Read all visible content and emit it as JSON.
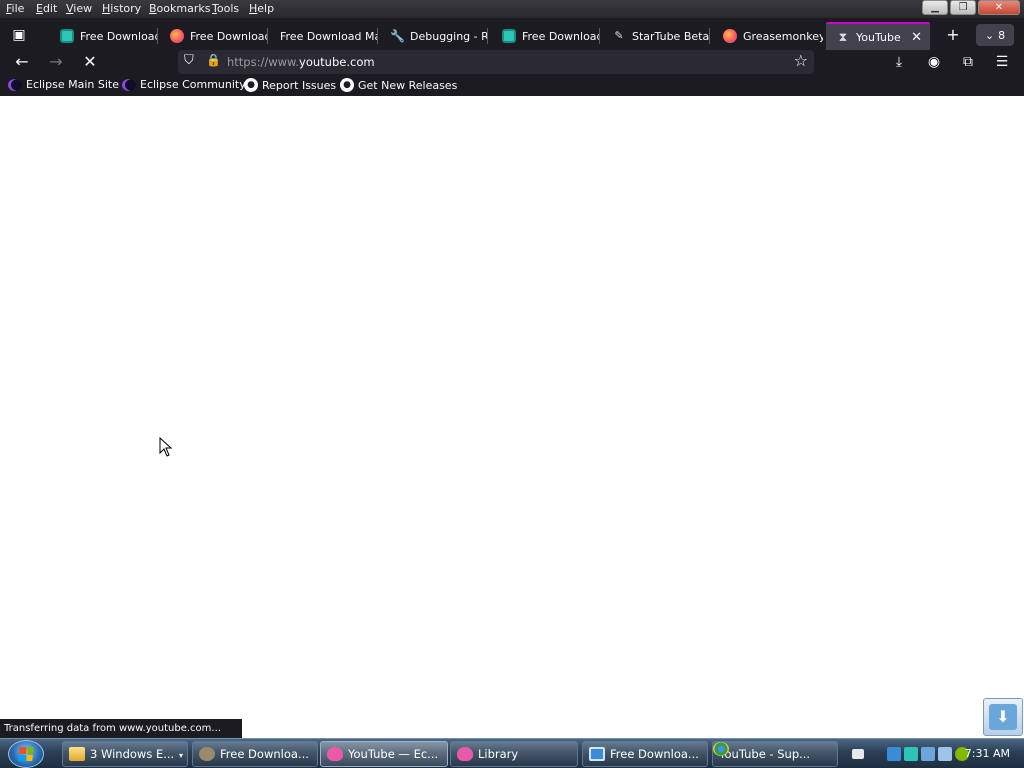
{
  "menubar": {
    "items": [
      "File",
      "Edit",
      "View",
      "History",
      "Bookmarks",
      "Tools",
      "Help"
    ]
  },
  "tabs": [
    {
      "label": "Free Download",
      "icon": "fdm-icon"
    },
    {
      "label": "Free Download",
      "icon": "firefox-icon"
    },
    {
      "label": "Free Download Ma",
      "icon": ""
    },
    {
      "label": "Debugging - R",
      "icon": "wrench-icon"
    },
    {
      "label": "Free Download",
      "icon": "fdm-icon"
    },
    {
      "label": "StarTube Beta",
      "icon": "wand-icon"
    },
    {
      "label": "Greasemonkey",
      "icon": "firefox-icon"
    },
    {
      "label": "YouTube",
      "icon": "hourglass-icon",
      "active": true
    }
  ],
  "all_tabs_count": "8",
  "url": {
    "prefix": "https://www.",
    "domain": "youtube.com"
  },
  "bookmarks": [
    {
      "label": "Eclipse Main Site",
      "icon": "eclipse-icon"
    },
    {
      "label": "Eclipse Community",
      "icon": "eclipse-icon"
    },
    {
      "label": "Report Issues",
      "icon": "github-icon"
    },
    {
      "label": "Get New Releases",
      "icon": "github-icon"
    }
  ],
  "status_text": "Transferring data from www.youtube.com...",
  "taskbar": {
    "items": [
      {
        "label": "3 Windows E...",
        "icon": "folder-icon"
      },
      {
        "label": "Free Downloa...",
        "icon": "gear-icon"
      },
      {
        "label": "YouTube — Ec...",
        "icon": "librewolf-icon",
        "active": true
      },
      {
        "label": "Library",
        "icon": "librewolf-icon"
      },
      {
        "label": "Free Downloa...",
        "icon": "fdm-icon"
      },
      {
        "label": "YouTube - Sup...",
        "icon": "chrome-icon"
      }
    ],
    "clock": "7:31 AM"
  },
  "colors": {
    "chrome_bg": "#1c1b22",
    "active_tab_accent": "#d000d0",
    "urlbar_bg": "#2b2a33"
  }
}
